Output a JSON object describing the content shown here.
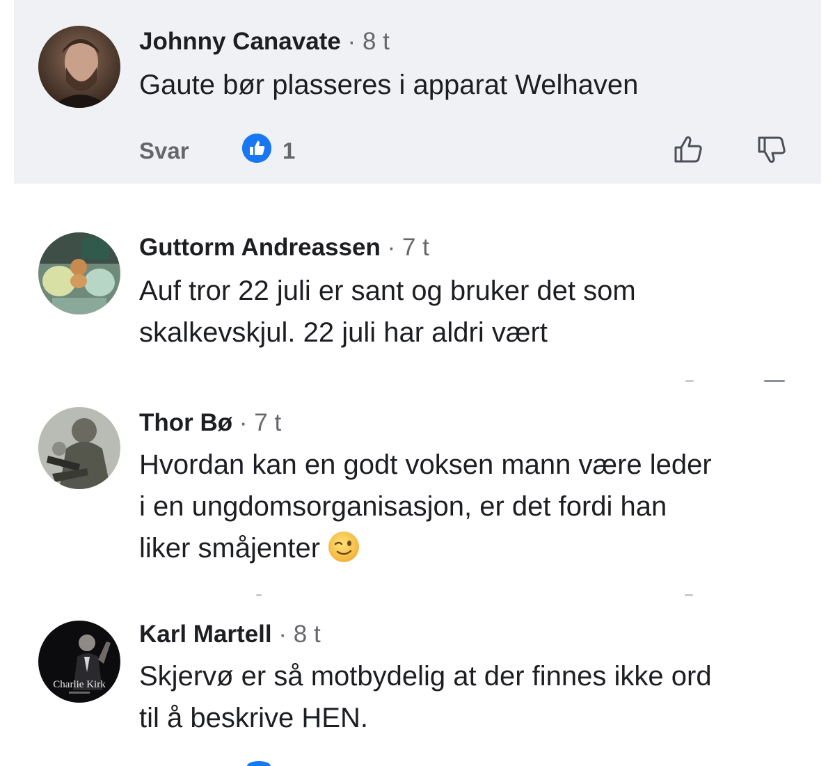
{
  "comments": [
    {
      "author": "Johnny Canavate",
      "separator": "·",
      "time": "8 t",
      "text": "Gaute bør plasseres i apparat Welhaven",
      "reply_label": "Svar",
      "like_count": "1",
      "highlighted": true
    },
    {
      "author": "Guttorm Andreassen",
      "separator": "·",
      "time": "7 t",
      "text_line1": "Auf tror 22 juli er sant og bruker det som",
      "text_line2": "skalkevskjul. 22 juli har aldri vært"
    },
    {
      "author": "Thor Bø",
      "separator": "·",
      "time": "7 t",
      "text_line1": "Hvordan kan en godt voksen mann være leder",
      "text_line2": "i en ungdomsorganisasjon, er det fordi han",
      "text_line3": "liker småjenter",
      "emoji": "winking-face"
    },
    {
      "author": "Karl Martell",
      "separator": "·",
      "time": "8 t",
      "text_line1": "Skjervø er så motbydelig at der finnes ikke ord",
      "text_line2": "til å beskrive HEN.",
      "avatar_text": "Charlie Kirk"
    }
  ],
  "colors": {
    "highlight_bg": "#f0f1f4",
    "name": "#1c1e21",
    "meta": "#65676b",
    "like_blue": "#1877f2"
  },
  "icons": {
    "like_badge": "thumbs-up-badge-icon",
    "upvote": "thumbs-up-outline-icon",
    "downvote": "thumbs-down-outline-icon"
  }
}
